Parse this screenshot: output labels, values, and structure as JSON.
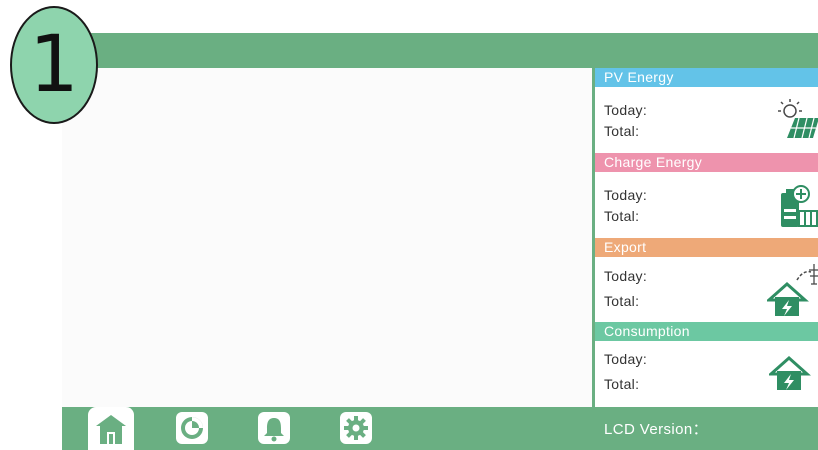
{
  "step_badge": "1",
  "sections": [
    {
      "title": "PV Energy",
      "color": "#63c3e8",
      "icon": "solar-panel-icon",
      "today_label": "Today:",
      "total_label": "Total:"
    },
    {
      "title": "Charge Energy",
      "color": "#ee93ad",
      "icon": "battery-charge-icon",
      "today_label": "Today:",
      "total_label": "Total:"
    },
    {
      "title": "Export",
      "color": "#eea978",
      "icon": "grid-export-icon",
      "today_label": "Today:",
      "total_label": "Total:"
    },
    {
      "title": "Consumption",
      "color": "#6cc8a2",
      "icon": "home-consumption-icon",
      "today_label": "Today:",
      "total_label": "Total:"
    }
  ],
  "footer": {
    "nav": [
      "home-icon",
      "pie-chart-icon",
      "bell-icon",
      "gear-icon"
    ],
    "lcd_version_label": "LCD Version："
  },
  "colors": {
    "theme_green": "#6aaf82",
    "icon_green": "#2f8e63"
  }
}
